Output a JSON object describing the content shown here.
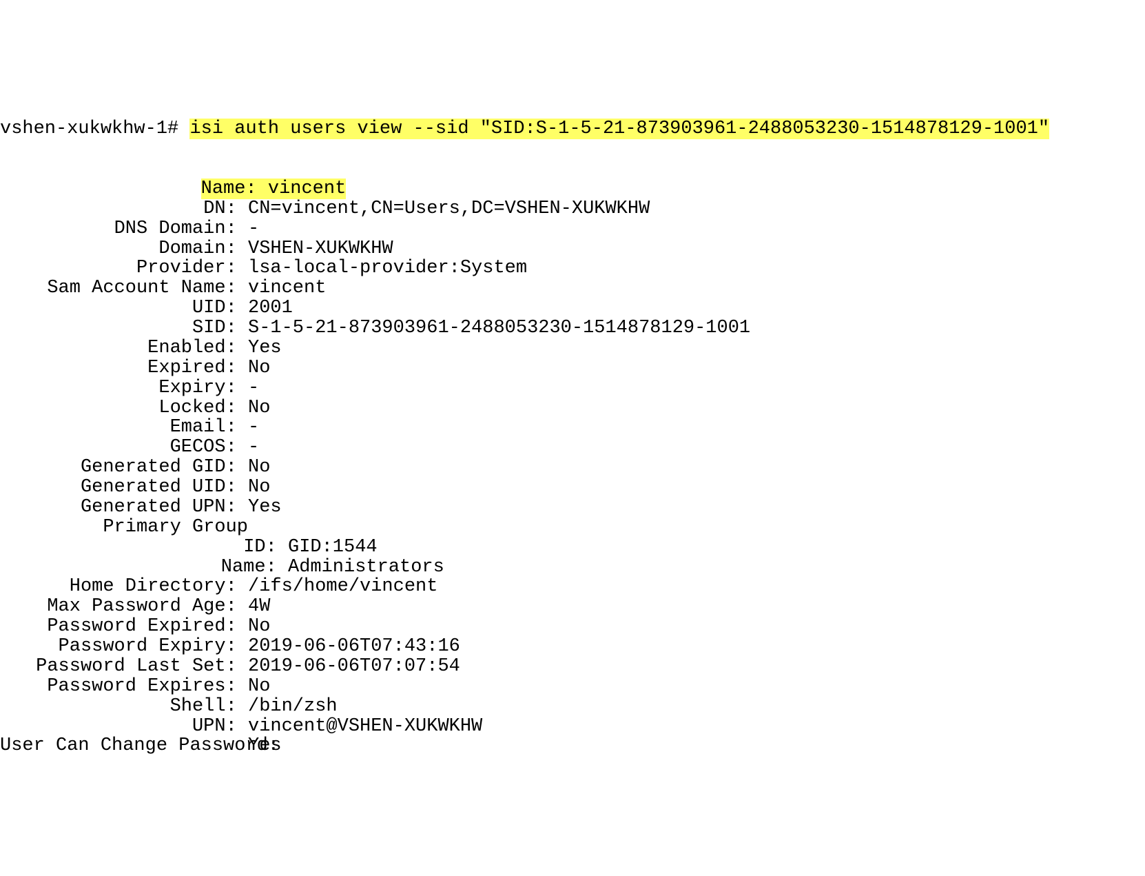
{
  "prompt": "vshen-xukwkhw-1# ",
  "command": "isi auth users view --sid \"SID:S-1-5-21-873903961-2488053230-1514878129-1001\"",
  "fields": [
    {
      "label": "Name",
      "value": "vincent",
      "highlight": true,
      "indent": 0
    },
    {
      "label": "DN",
      "value": "CN=vincent,CN=Users,DC=VSHEN-XUKWKHW",
      "indent": 0
    },
    {
      "label": "DNS Domain",
      "value": "-",
      "indent": 0
    },
    {
      "label": "Domain",
      "value": "VSHEN-XUKWKHW",
      "indent": 0
    },
    {
      "label": "Provider",
      "value": "lsa-local-provider:System",
      "indent": 0
    },
    {
      "label": "Sam Account Name",
      "value": "vincent",
      "indent": 0
    },
    {
      "label": "UID",
      "value": "2001",
      "indent": 0
    },
    {
      "label": "SID",
      "value": "S-1-5-21-873903961-2488053230-1514878129-1001",
      "indent": 0
    },
    {
      "label": "Enabled",
      "value": "Yes",
      "indent": 0
    },
    {
      "label": "Expired",
      "value": "No",
      "indent": 0
    },
    {
      "label": "Expiry",
      "value": "-",
      "indent": 0
    },
    {
      "label": "Locked",
      "value": "No",
      "indent": 0
    },
    {
      "label": "Email",
      "value": "-",
      "indent": 0
    },
    {
      "label": "GECOS",
      "value": "-",
      "indent": 0
    },
    {
      "label": "Generated GID",
      "value": "No",
      "indent": 0
    },
    {
      "label": "Generated UID",
      "value": "No",
      "indent": 0
    },
    {
      "label": "Generated UPN",
      "value": "Yes",
      "indent": 0
    },
    {
      "label": "Primary Group",
      "value": "",
      "nocolon_value": true,
      "indent": 0
    },
    {
      "label": "ID",
      "value": "GID:1544",
      "indent": 1
    },
    {
      "label": "Name",
      "value": "Administrators",
      "indent": 1
    },
    {
      "label": "Home Directory",
      "value": "/ifs/home/vincent",
      "indent": 0
    },
    {
      "label": "Max Password Age",
      "value": "4W",
      "indent": 0
    },
    {
      "label": "Password Expired",
      "value": "No",
      "indent": 0
    },
    {
      "label": "Password Expiry",
      "value": "2019-06-06T07:43:16",
      "indent": 0
    },
    {
      "label": "Password Last Set",
      "value": "2019-06-06T07:07:54",
      "indent": 0
    },
    {
      "label": "Password Expires",
      "value": "No",
      "indent": 0
    },
    {
      "label": "Shell",
      "value": "/bin/zsh",
      "indent": 0
    },
    {
      "label": "UPN",
      "value": "vincent@VSHEN-XUKWKHW",
      "indent": 0
    },
    {
      "label": "User Can Change Password",
      "value": "Yes",
      "indent": 0
    }
  ]
}
